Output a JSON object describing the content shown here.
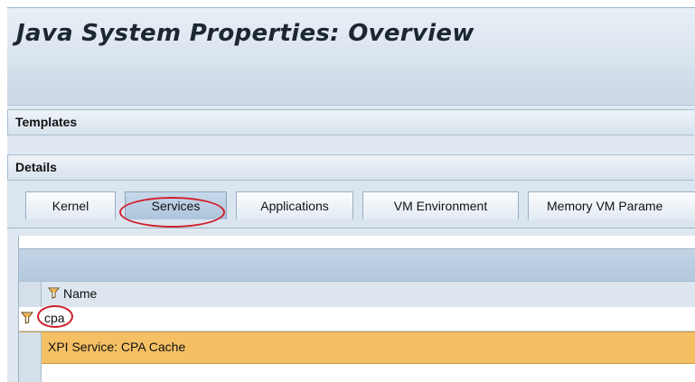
{
  "title": "Java System Properties: Overview",
  "sections": {
    "templates": "Templates",
    "details": "Details"
  },
  "tabs": [
    {
      "label": "Kernel",
      "active": false
    },
    {
      "label": "Services",
      "active": true
    },
    {
      "label": "Applications",
      "active": false
    },
    {
      "label": "VM Environment",
      "active": false
    },
    {
      "label": "Memory VM Parame",
      "active": false
    }
  ],
  "table": {
    "columns": [
      "Name"
    ],
    "filter_value": "cpa",
    "rows": [
      {
        "name": "XPI Service: CPA Cache",
        "selected": true
      }
    ]
  },
  "colors": {
    "highlight_oval": "#d0202a",
    "selected_row": "#f5c064",
    "header_bg": "#dfe8f1"
  },
  "icons": {
    "column_filter": "funnel-icon",
    "filter_row": "funnel-icon"
  }
}
